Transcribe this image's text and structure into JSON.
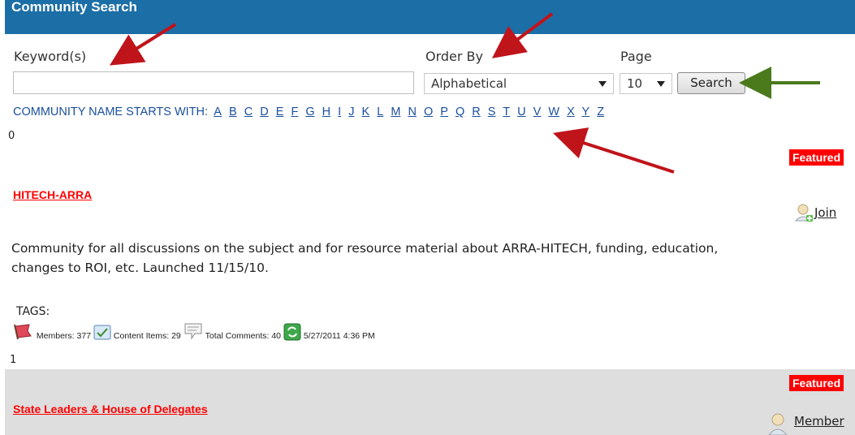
{
  "header": {
    "title": "Community Search"
  },
  "labels": {
    "keywords": "Keyword(s)",
    "order_by": "Order By",
    "page": "Page"
  },
  "search": {
    "keyword_value": "",
    "order_by_value": "Alphabetical",
    "page_value": "10",
    "button_label": "Search"
  },
  "alpha": {
    "prefix": "COMMUNITY NAME STARTS WITH:",
    "letters": [
      "A",
      "B",
      "C",
      "D",
      "E",
      "F",
      "G",
      "H",
      "I",
      "J",
      "K",
      "L",
      "M",
      "N",
      "O",
      "P",
      "Q",
      "R",
      "S",
      "T",
      "U",
      "V",
      "W",
      "X",
      "Y",
      "Z"
    ]
  },
  "results": [
    {
      "index": "0",
      "featured": "Featured",
      "title": "HITECH-ARRA",
      "action": "Join",
      "description": "Community for all discussions on the subject and for resource material about ARRA-HITECH, funding, education, changes to ROI, etc. Launched 11/15/10.",
      "tags_label": "TAGS:",
      "members": "Members: 377",
      "content_items": "Content Items: 29",
      "total_comments": "Total Comments: 40",
      "updated": "5/27/2011 4:36 PM"
    },
    {
      "index": "1",
      "featured": "Featured",
      "title": "State Leaders & House of Delegates",
      "action": "Member"
    }
  ],
  "colors": {
    "header_bg": "#1c6ea6",
    "featured_bg": "#ff0000",
    "link": "#1a4f9c",
    "title": "#ff0000",
    "arrow_red": "#c0141b",
    "arrow_green": "#4a7a1c"
  },
  "icons": [
    "flag-icon",
    "content-icon",
    "comment-icon",
    "refresh-icon",
    "user-add-icon",
    "user-icon"
  ]
}
